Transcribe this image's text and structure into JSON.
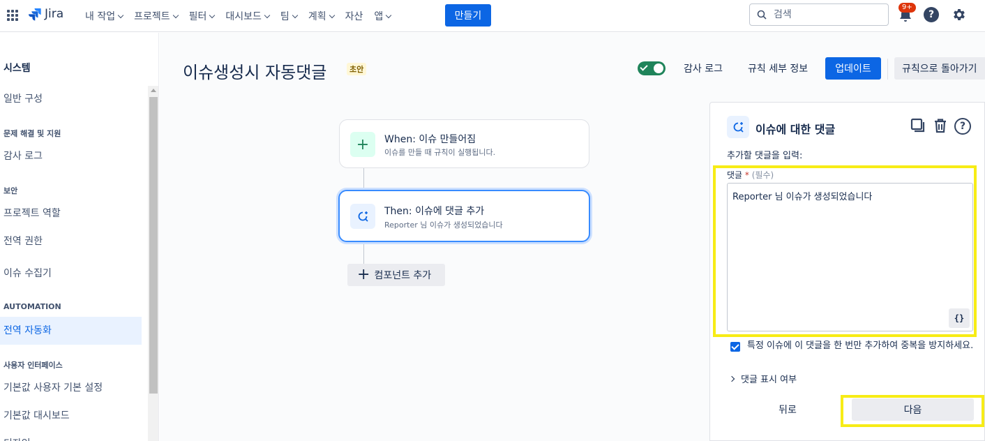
{
  "topnav": {
    "logo_text": "Jira",
    "menu": [
      {
        "label": "내 작업",
        "has_dropdown": true
      },
      {
        "label": "프로젝트",
        "has_dropdown": true
      },
      {
        "label": "필터",
        "has_dropdown": true
      },
      {
        "label": "대시보드",
        "has_dropdown": true
      },
      {
        "label": "팀",
        "has_dropdown": true
      },
      {
        "label": "계획",
        "has_dropdown": true
      },
      {
        "label": "자산",
        "has_dropdown": false
      },
      {
        "label": "앱",
        "has_dropdown": true
      }
    ],
    "create_label": "만들기",
    "search_placeholder": "검색",
    "notification_badge": "9+",
    "accent_color": "#0c66e4"
  },
  "sidebar": {
    "title": "시스템",
    "items": [
      {
        "type": "item",
        "label": "일반 구성"
      },
      {
        "type": "heading",
        "label": "문제 해결 및 지원"
      },
      {
        "type": "item",
        "label": "감사 로그"
      },
      {
        "type": "heading",
        "label": "보안"
      },
      {
        "type": "item",
        "label": "프로젝트 역할"
      },
      {
        "type": "item",
        "label": "전역 권한"
      },
      {
        "type": "item",
        "label": "이슈 수집기"
      },
      {
        "type": "heading",
        "label": "AUTOMATION"
      },
      {
        "type": "item",
        "label": "전역 자동화",
        "active": true
      },
      {
        "type": "heading",
        "label": "사용자 인터페이스"
      },
      {
        "type": "item",
        "label": "기본값 사용자 기본 설정"
      },
      {
        "type": "item",
        "label": "기본값 대시보드"
      },
      {
        "type": "item",
        "label": "디자인"
      }
    ]
  },
  "rule": {
    "title": "이슈생성시 자동댓글",
    "status_badge": "초안",
    "enabled": true,
    "audit_log_label": "감사 로그",
    "rule_details_label": "규칙 세부 정보",
    "update_label": "업데이트",
    "back_to_rules_label": "규칙으로 돌아가기"
  },
  "flow": {
    "trigger": {
      "title": "When: 이슈 만들어짐",
      "subtitle": "이슈를 만들 때 규칙이 실행됩니다."
    },
    "action": {
      "title": "Then: 이슈에 댓글 추가",
      "subtitle": "Reporter 님 이슈가 생성되었습니다"
    },
    "add_component_label": "컴포넌트 추가"
  },
  "panel": {
    "title": "이슈에 대한 댓글",
    "description": "추가할 댓글을 입력:",
    "field_label": "댓글",
    "required_mark": "*",
    "required_note": "(필수)",
    "comment_value": "Reporter 님 이슈가 생성되었습니다",
    "smart_value_button": "{}",
    "checkbox_checked": true,
    "checkbox_label": "특정 이슈에 이 댓글을 한 번만 추가하여 중복을 방지하세요.",
    "visibility_label": "댓글 표시 여부",
    "back_label": "뒤로",
    "next_label": "다음",
    "highlight_color": "#f7ec16"
  }
}
